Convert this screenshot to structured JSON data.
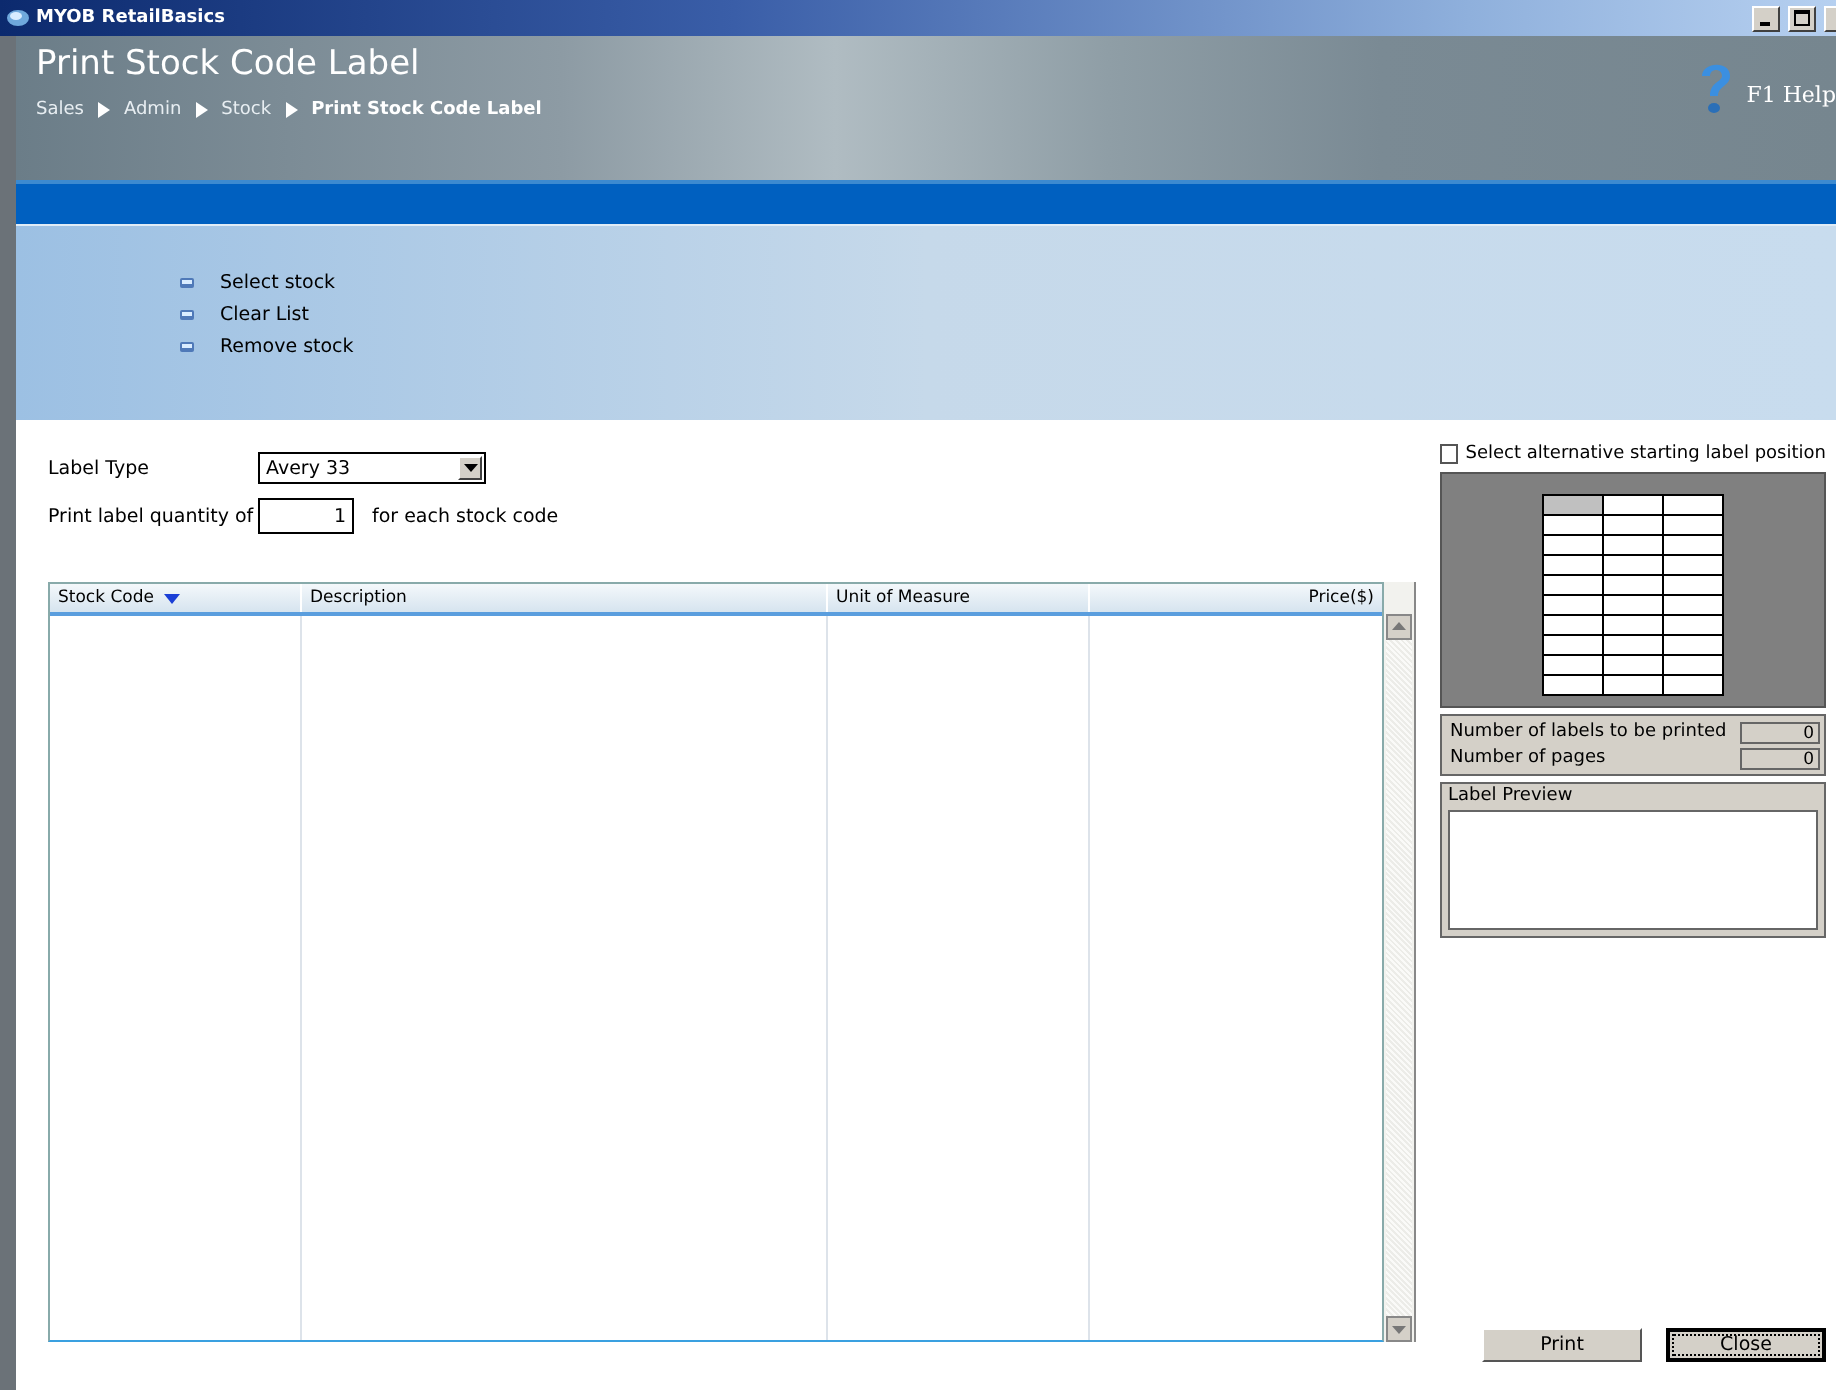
{
  "window": {
    "title": "MYOB RetailBasics"
  },
  "header": {
    "title": "Print Stock Code Label",
    "help": "F1 Help",
    "breadcrumb": [
      {
        "label": "Sales",
        "current": false
      },
      {
        "label": "Admin",
        "current": false
      },
      {
        "label": "Stock",
        "current": false
      },
      {
        "label": "Print Stock Code Label",
        "current": true
      }
    ]
  },
  "actions": [
    "Select stock",
    "Clear List",
    "Remove stock"
  ],
  "form": {
    "label_type": {
      "label": "Label Type",
      "value": "Avery 33"
    },
    "quantity": {
      "label": "Print label quantity of",
      "value": "1",
      "suffix": "for each stock code"
    }
  },
  "table": {
    "columns": [
      {
        "label": "Stock Code",
        "sorted": true
      },
      {
        "label": "Description",
        "sorted": false
      },
      {
        "label": "Unit of Measure",
        "sorted": false
      },
      {
        "label": "Price($)",
        "sorted": false
      }
    ]
  },
  "position_panel": {
    "label": "Select alternative starting label position",
    "checked": false,
    "label_grid": [
      {
        "cells": [
          {
            "selected": true
          },
          {
            "selected": false
          },
          {
            "selected": false
          }
        ]
      },
      {
        "cells": [
          {
            "selected": false
          },
          {
            "selected": false
          },
          {
            "selected": false
          }
        ]
      },
      {
        "cells": [
          {
            "selected": false
          },
          {
            "selected": false
          },
          {
            "selected": false
          }
        ]
      },
      {
        "cells": [
          {
            "selected": false
          },
          {
            "selected": false
          },
          {
            "selected": false
          }
        ]
      },
      {
        "cells": [
          {
            "selected": false
          },
          {
            "selected": false
          },
          {
            "selected": false
          }
        ]
      },
      {
        "cells": [
          {
            "selected": false
          },
          {
            "selected": false
          },
          {
            "selected": false
          }
        ]
      },
      {
        "cells": [
          {
            "selected": false
          },
          {
            "selected": false
          },
          {
            "selected": false
          }
        ]
      },
      {
        "cells": [
          {
            "selected": false
          },
          {
            "selected": false
          },
          {
            "selected": false
          }
        ]
      },
      {
        "cells": [
          {
            "selected": false
          },
          {
            "selected": false
          },
          {
            "selected": false
          }
        ]
      },
      {
        "cells": [
          {
            "selected": false
          },
          {
            "selected": false
          },
          {
            "selected": false
          }
        ]
      }
    ]
  },
  "counts": [
    {
      "label": "Number of labels to be printed",
      "value": "0"
    },
    {
      "label": "Number of pages",
      "value": "0"
    }
  ],
  "preview": {
    "label": "Label Preview"
  },
  "buttons": [
    {
      "label": "Print",
      "focused": false
    },
    {
      "label": "Close",
      "focused": true
    }
  ]
}
